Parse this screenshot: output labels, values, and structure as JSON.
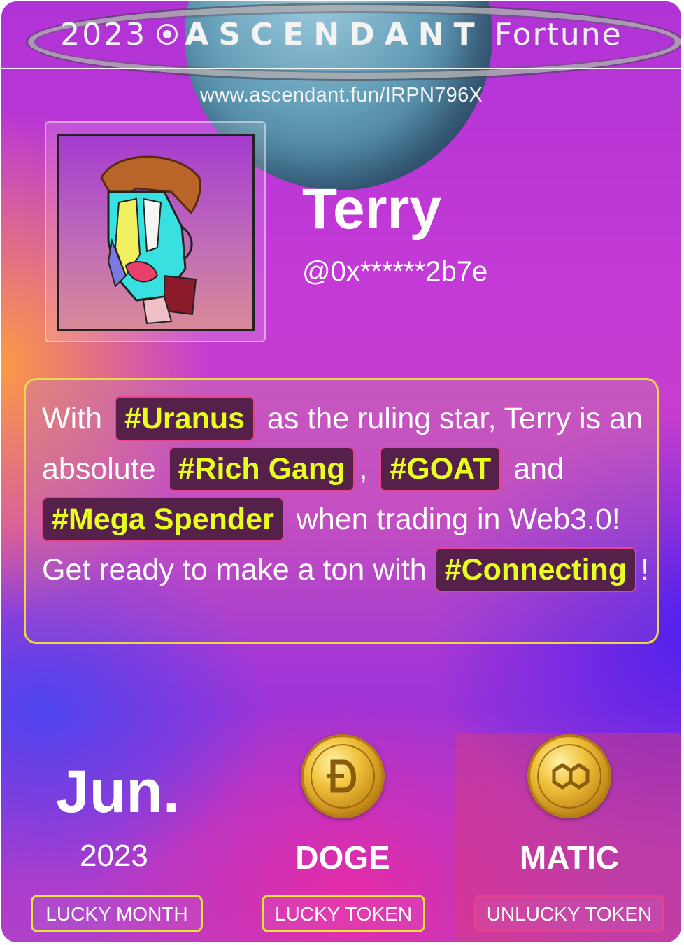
{
  "header": {
    "year": "2023",
    "brand_name": "ASCENDANT",
    "brand_suffix": "Fortune",
    "url": "www.ascendant.fun/IRPN796X"
  },
  "profile": {
    "name": "Terry",
    "handle": "@0x******2b7e"
  },
  "fortune": {
    "t1": "With",
    "tag_star": "#Uranus",
    "t2": "as the ruling star, Terry is an absolute",
    "tag_1": "#Rich Gang",
    "t3": ",",
    "tag_2": "#GOAT",
    "t4": "and",
    "tag_3": "#Mega Spender",
    "t5": "when trading in Web3.0! Get ready to make a ton with",
    "tag_4": "#Connecting",
    "t6": "!"
  },
  "lucky_month": {
    "month": "Jun.",
    "year": "2023",
    "label": "LUCKY MONTH"
  },
  "lucky_token": {
    "name": "DOGE",
    "label": "LUCKY TOKEN",
    "icon": "dogecoin-icon"
  },
  "unlucky_token": {
    "name": "MATIC",
    "label": "UNLUCKY TOKEN",
    "icon": "polygon-icon"
  },
  "colors": {
    "tag_text": "#e6ff1f",
    "tag_bg": "#55204a",
    "tag_border": "#e7428c",
    "lucky_border": "#e4e63a",
    "unlucky_border": "#e7428c"
  }
}
